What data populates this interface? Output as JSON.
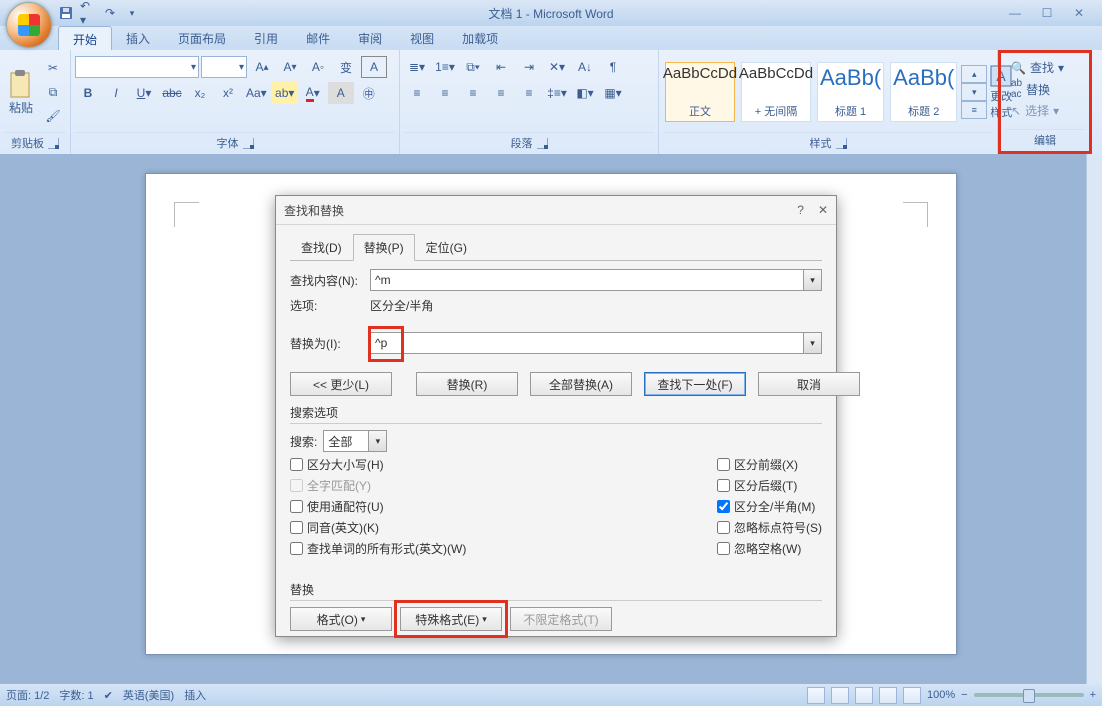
{
  "title": "文档 1 - Microsoft Word",
  "tabs": {
    "home": "开始",
    "insert": "插入",
    "layout": "页面布局",
    "ref": "引用",
    "mail": "邮件",
    "review": "审阅",
    "view": "视图",
    "addin": "加载项"
  },
  "groups": {
    "clipboard": "剪贴板",
    "font": "字体",
    "para": "段落",
    "styles": "样式",
    "editing": "编辑"
  },
  "clipboard": {
    "paste": "粘贴"
  },
  "styles": {
    "normal": "正文",
    "nosp": "+ 无间隔",
    "h1": "标题 1",
    "h2": "标题 2",
    "change": "更改样式",
    "sample": "AaBbCcDd",
    "sampleBig": "AaBb(",
    "sampleBig2": "AaBb("
  },
  "edit": {
    "find": "查找",
    "replace": "替换",
    "select": "选择"
  },
  "dialog": {
    "title": "查找和替换",
    "tabs": {
      "find": "查找(D)",
      "replace": "替换(P)",
      "goto": "定位(G)"
    },
    "findLabel": "查找内容(N):",
    "findVal": "^m",
    "optLabel": "选项:",
    "optVal": "区分全/半角",
    "replLabel": "替换为(I):",
    "replVal": "^p",
    "less": "<< 更少(L)",
    "btns": {
      "replace": "替换(R)",
      "replaceAll": "全部替换(A)",
      "findNext": "查找下一处(F)",
      "cancel": "取消"
    },
    "searchOpts": "搜索选项",
    "searchLbl": "搜索:",
    "searchVal": "全部",
    "chk": {
      "case": "区分大小写(H)",
      "whole": "全字匹配(Y)",
      "wildcard": "使用通配符(U)",
      "sounds": "同音(英文)(K)",
      "forms": "查找单词的所有形式(英文)(W)",
      "prefix": "区分前缀(X)",
      "suffix": "区分后缀(T)",
      "width": "区分全/半角(M)",
      "punct": "忽略标点符号(S)",
      "space": "忽略空格(W)"
    },
    "replaceSect": "替换",
    "format": "格式(O)",
    "special": "特殊格式(E)",
    "noformat": "不限定格式(T)"
  },
  "status": {
    "page": "页面: 1/2",
    "words": "字数: 1",
    "lang": "英语(美国)",
    "mode": "插入",
    "zoom": "100%"
  }
}
